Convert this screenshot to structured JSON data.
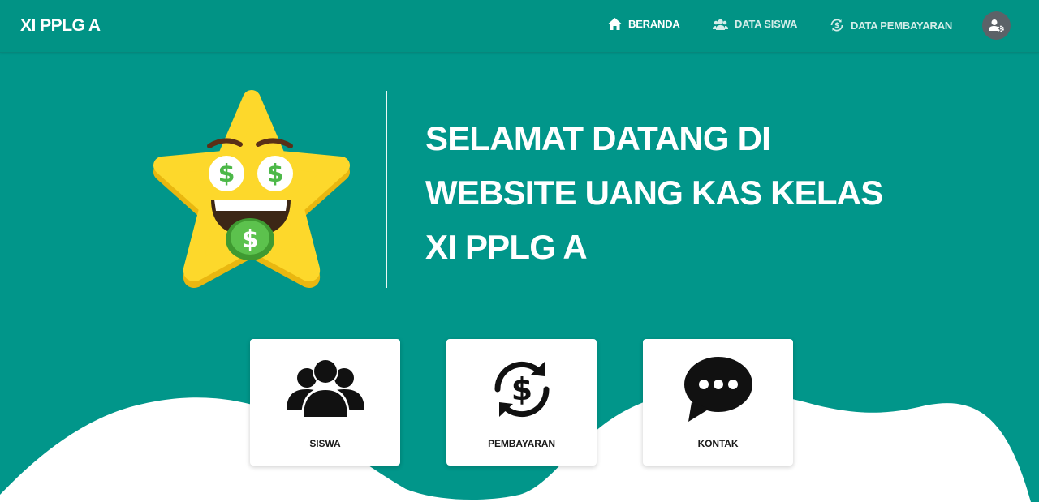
{
  "navbar": {
    "brand": "XI PPLG A",
    "items": [
      {
        "label": "BERANDA",
        "icon": "home-icon",
        "active": true
      },
      {
        "label": "DATA SISWA",
        "icon": "users-icon",
        "active": false
      },
      {
        "label": "DATA PEMBAYARAN",
        "icon": "money-cycle-icon",
        "active": false
      }
    ],
    "account_icon": "user-gear-icon"
  },
  "hero": {
    "illustration": "money-star-emoji",
    "title_lines": [
      "SELAMAT DATANG DI",
      "WEBSITE UANG KAS KELAS",
      "XI PPLG A"
    ]
  },
  "cards": [
    {
      "label": "SISWA",
      "icon": "group-users-icon"
    },
    {
      "label": "PEMBAYARAN",
      "icon": "dollar-cycle-icon"
    },
    {
      "label": "KONTAK",
      "icon": "chat-bubble-icon"
    }
  ],
  "colors": {
    "primary": "#01968a",
    "star": "#fdd82b",
    "money_green": "#4cb848",
    "card": "#ffffff"
  }
}
